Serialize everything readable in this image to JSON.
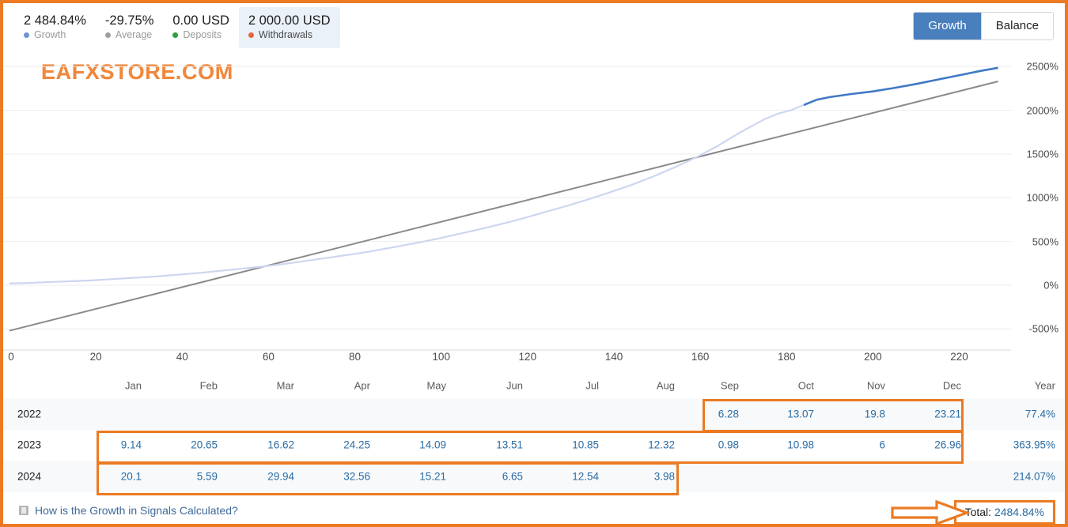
{
  "header": {
    "stats": [
      {
        "value": "2 484.84%",
        "label": "Growth",
        "dot": "#6f93d6",
        "icon": "legend-dot-growth",
        "highlight": false
      },
      {
        "value": "-29.75%",
        "label": "Average",
        "dot": "#9e9e9e",
        "icon": "legend-dot-average",
        "highlight": false
      },
      {
        "value": "0.00 USD",
        "label": "Deposits",
        "dot": "#2f9e44",
        "icon": "legend-dot-deposits",
        "highlight": false
      },
      {
        "value": "2 000.00 USD",
        "label": "Withdrawals",
        "dot": "#e8643c",
        "icon": "legend-dot-withdrawals",
        "highlight": true
      }
    ],
    "toggle": {
      "growth_label": "Growth",
      "balance_label": "Balance",
      "active": "Growth"
    }
  },
  "watermark": "EAFXSTORE.COM",
  "chart_data": {
    "type": "line",
    "title": "",
    "xlabel": "",
    "ylabel": "",
    "ylim": [
      -750,
      2700
    ],
    "ytick_labels": [
      "2500%",
      "2000%",
      "1500%",
      "1000%",
      "500%",
      "0%",
      "-500%"
    ],
    "ytick_values": [
      2500,
      2000,
      1500,
      1000,
      500,
      0,
      -500
    ],
    "xlim": [
      0,
      232
    ],
    "xtick_labels": [
      "0",
      "20",
      "40",
      "60",
      "80",
      "100",
      "120",
      "140",
      "160",
      "180",
      "200",
      "220"
    ],
    "xtick_values": [
      0,
      20,
      40,
      60,
      80,
      100,
      120,
      140,
      160,
      180,
      200,
      220
    ],
    "month_labels": [
      "Jan",
      "Feb",
      "Mar",
      "Apr",
      "May",
      "Jun",
      "Jul",
      "Aug",
      "Sep",
      "Oct",
      "Nov",
      "Dec",
      "Year"
    ],
    "grid": true,
    "legend_position": "top-left",
    "series": [
      {
        "name": "Growth",
        "color": "#3f79c4",
        "muted_color": "#ccd6ef",
        "x": [
          0,
          4,
          9,
          14,
          19,
          24,
          29,
          34,
          39,
          44,
          49,
          54,
          59,
          64,
          69,
          74,
          79,
          84,
          89,
          94,
          99,
          104,
          109,
          114,
          119,
          124,
          129,
          134,
          139,
          144,
          149,
          154,
          159,
          164,
          169,
          172,
          175,
          178,
          181,
          184,
          187,
          190,
          195,
          200,
          205,
          210,
          215,
          220,
          225,
          229
        ],
        "y": [
          20,
          25,
          35,
          45,
          55,
          70,
          85,
          100,
          120,
          140,
          165,
          190,
          215,
          245,
          280,
          315,
          350,
          390,
          435,
          480,
          530,
          585,
          640,
          700,
          765,
          835,
          905,
          980,
          1060,
          1145,
          1240,
          1345,
          1460,
          1590,
          1740,
          1820,
          1900,
          1960,
          2000,
          2060,
          2120,
          2150,
          2185,
          2215,
          2255,
          2300,
          2350,
          2400,
          2450,
          2485
        ]
      },
      {
        "name": "Average",
        "color": "#8a8a8a",
        "x": [
          0,
          229
        ],
        "y": [
          -520,
          2330
        ]
      }
    ]
  },
  "table": {
    "columns": [
      "",
      "Jan",
      "Feb",
      "Mar",
      "Apr",
      "May",
      "Jun",
      "Jul",
      "Aug",
      "Sep",
      "Oct",
      "Nov",
      "Dec",
      "Year"
    ],
    "rows": [
      {
        "year": "2022",
        "months": [
          "",
          "",
          "",
          "",
          "",
          "",
          "",
          "",
          "6.28",
          "13.07",
          "19.8",
          "23.21"
        ],
        "total": "77.4%"
      },
      {
        "year": "2023",
        "months": [
          "9.14",
          "20.65",
          "16.62",
          "24.25",
          "14.09",
          "13.51",
          "10.85",
          "12.32",
          "0.98",
          "10.98",
          "6",
          "26.96"
        ],
        "total": "363.95%"
      },
      {
        "year": "2024",
        "months": [
          "20.1",
          "5.59",
          "29.94",
          "32.56",
          "15.21",
          "6.65",
          "12.54",
          "3.98",
          "",
          "",
          "",
          ""
        ],
        "total": "214.07%"
      }
    ]
  },
  "footer": {
    "how_link": "How is the Growth in Signals Calculated?",
    "total_prefix": "Total: ",
    "total_value": "2484.84%"
  },
  "colors": {
    "accent_orange": "#ec7a23",
    "link_blue": "#2b6ca3",
    "toggle_active": "#4a7fbe"
  }
}
